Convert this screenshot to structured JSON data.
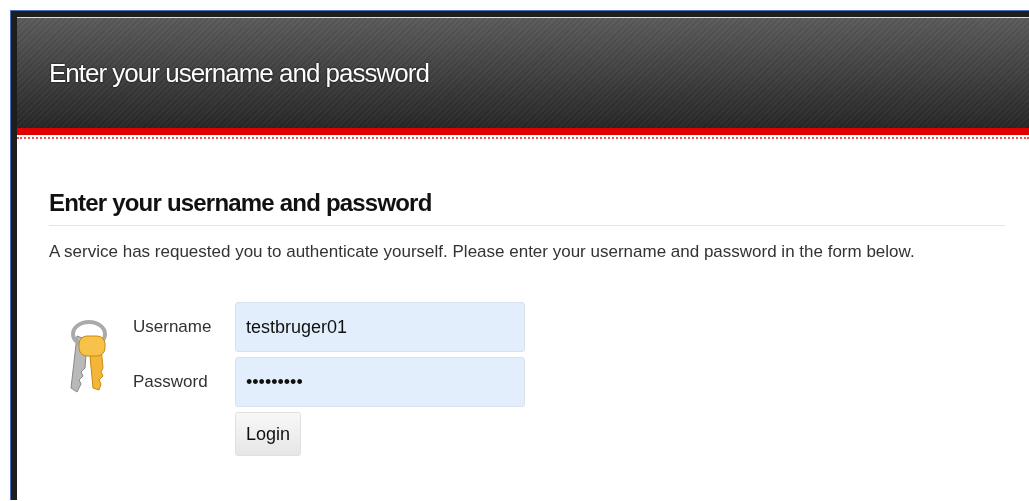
{
  "header": {
    "title": "Enter your username and password"
  },
  "heading": "Enter your username and password",
  "intro": "A service has requested you to authenticate yourself. Please enter your username and password in the form below.",
  "fields": [
    {
      "label": "Username",
      "value": "testbruger01"
    },
    {
      "label": "Password",
      "value": "•••••••••"
    }
  ],
  "buttons": [
    "Login"
  ]
}
